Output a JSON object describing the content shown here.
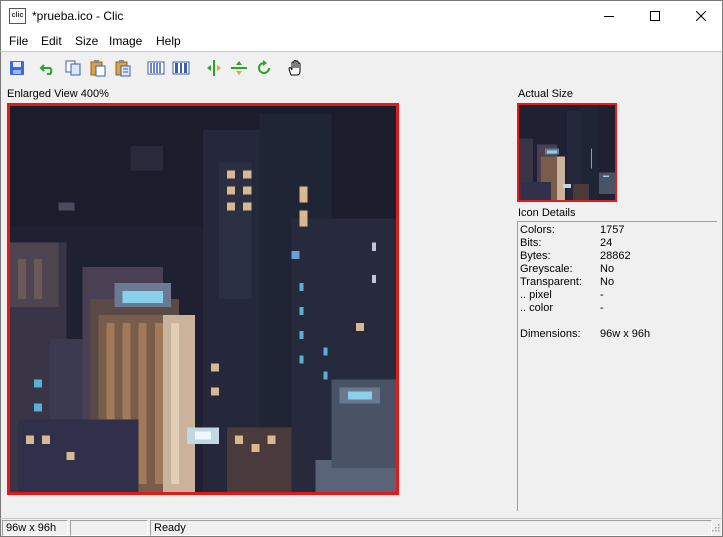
{
  "window": {
    "title": "*prueba.ico - Clic",
    "app_icon_text": "clic"
  },
  "menu": {
    "items": [
      "File",
      "Edit",
      "Size",
      "Image",
      "Help"
    ]
  },
  "toolbar": {
    "buttons": [
      "save-icon",
      "undo-icon",
      "copy-icon",
      "paste-icon",
      "paste-special-icon",
      "stretch-horizontal-icon",
      "stretch-vertical-icon",
      "flip-horizontal-icon",
      "flip-vertical-icon",
      "rotate-icon",
      "hand-icon"
    ]
  },
  "views": {
    "enlarged_label": "Enlarged View 400%",
    "actual_label": "Actual Size"
  },
  "details": {
    "heading": "Icon Details",
    "rows": [
      {
        "key": "Colors:",
        "value": "1757"
      },
      {
        "key": "Bits:",
        "value": "24"
      },
      {
        "key": "Bytes:",
        "value": "28862"
      },
      {
        "key": "Greyscale:",
        "value": "No"
      },
      {
        "key": "Transparent:",
        "value": "No"
      },
      {
        "key": ".. pixel",
        "value": "-"
      },
      {
        "key": ".. color",
        "value": "-"
      },
      {
        "key": "Dimensions:",
        "value": "96w x 96h"
      }
    ]
  },
  "status": {
    "dimensions": "96w x 96h",
    "middle": "",
    "message": "Ready"
  },
  "colors": {
    "frame_red": "#e21a1a",
    "save_blue": "#3b6bd6",
    "arrow_green": "#2aa52a"
  }
}
